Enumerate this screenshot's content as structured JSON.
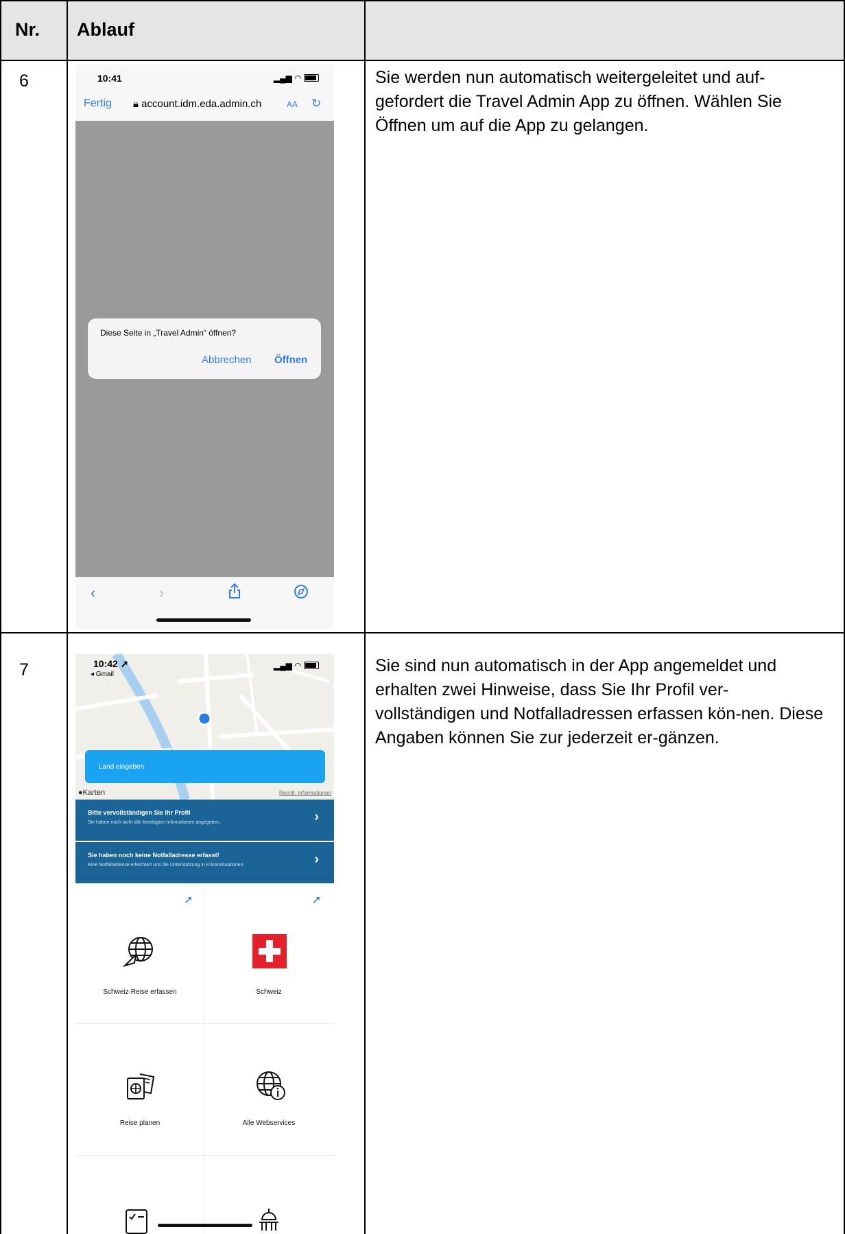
{
  "table": {
    "header": {
      "nr": "Nr.",
      "ablauf": "Ablauf",
      "empty": ""
    },
    "rows": [
      {
        "nr": "6",
        "description": "Sie werden nun automatisch weitergeleitet und auf-gefordert die Travel Admin App zu öffnen. Wählen Sie Öffnen um auf die App zu gelangen."
      },
      {
        "nr": "7",
        "description": "Sie sind nun automatisch in der App angemeldet und erhalten zwei Hinweise, dass Sie Ihr Profil ver-vollständigen und Notfalladressen erfassen kön-nen. Diese Angaben können Sie zur jederzeit er-gänzen."
      }
    ]
  },
  "safari": {
    "time": "10:41",
    "done": "Fertig",
    "url": "account.idm.eda.admin.ch",
    "aa": "AA",
    "dialog": {
      "title": "Diese Seite in „Travel Admin“ öffnen?",
      "cancel": "Abbrechen",
      "open": "Öffnen"
    },
    "icons": [
      "back-icon",
      "forward-icon",
      "share-icon",
      "compass-icon"
    ]
  },
  "app": {
    "time": "10:42",
    "back_app": "◂ Gmail",
    "country_input": "Land eingeben",
    "map_brand": "Karten",
    "map_legal": "Rechtl. Informationen",
    "banners": [
      {
        "title": "Bitte vervollständigen Sie Ihr Profil",
        "subtitle": "Sie haben noch nicht alle benötigten Infomationen angegeben."
      },
      {
        "title": "Sie haben noch keine Notfalladresse erfasst!",
        "subtitle": "Eine Notfalladresse erleichtert uns die Unterstützung in Krisensituationen."
      }
    ],
    "tiles": [
      {
        "label": "Schweiz-Reise erfassen",
        "icon": "globe-plane-icon"
      },
      {
        "label": "Schweiz",
        "icon": "swiss-flag-icon"
      },
      {
        "label": "Reise planen",
        "icon": "passport-ticket-icon"
      },
      {
        "label": "Alle Webservices",
        "icon": "globe-info-icon"
      }
    ],
    "colors": {
      "banner": "#1b6498",
      "input": "#1aa3f0",
      "flag": "#e3202c"
    }
  }
}
